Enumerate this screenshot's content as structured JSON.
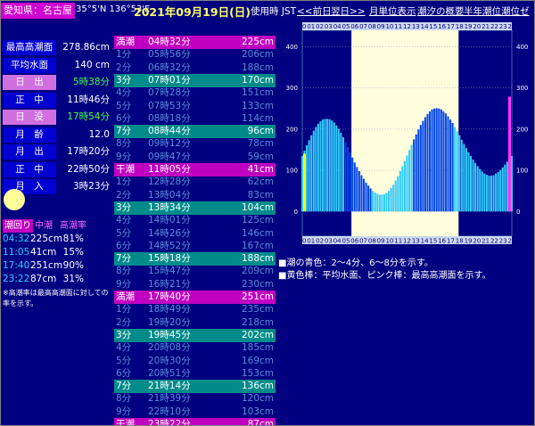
{
  "header": {
    "location": "愛知県：名古屋",
    "coord": "35°5'N 136°53'E",
    "date": "2021年09月19日(日)",
    "jst": "使用時 JST",
    "nav_prev": "<<前日",
    "nav_next": "翌日>>",
    "nav_month": "月単位表示",
    "nav_summary": "潮汐の概要",
    "nav_half": "半年潮位",
    "nav_zero": "潮位ゼロ"
  },
  "colors": {
    "background": "#000080",
    "high_water": "#c000c0",
    "mid_water": "#008b8b",
    "label_blue": "#0000d0",
    "label_pink": "#d070e0",
    "sunrise_text": "#44ff44"
  },
  "stats": [
    {
      "label": "最高高潮面",
      "value": "278.86cm",
      "pink": false,
      "green": false
    },
    {
      "label": "平均水面",
      "value": "140 cm",
      "pink": false,
      "green": false
    },
    {
      "label": "日　出",
      "value": "5時38分",
      "pink": true,
      "green": true
    },
    {
      "label": "正　中",
      "value": "11時46分",
      "pink": false,
      "green": false
    },
    {
      "label": "日　没",
      "value": "17時54分",
      "pink": true,
      "green": true
    },
    {
      "label": "月　齢",
      "value": "12.0",
      "pink": false,
      "green": false
    },
    {
      "label": "月　出",
      "value": "17時20分",
      "pink": false,
      "green": false
    },
    {
      "label": "正　中",
      "value": "22時50分",
      "pink": false,
      "green": false
    },
    {
      "label": "月　入",
      "value": "3時23分",
      "pink": false,
      "green": false
    }
  ],
  "tide_legend": {
    "label_full": "潮回り",
    "label_mid": "中潮",
    "label_rate": "高潮率"
  },
  "tide_summary": [
    {
      "time": "04:32",
      "level": "225cm",
      "rate": "81%"
    },
    {
      "time": "11:05",
      "level": "41cm",
      "rate": "15%"
    },
    {
      "time": "17:40",
      "level": "251cm",
      "rate": "90%"
    },
    {
      "time": "23:22",
      "level": "87cm",
      "rate": "31%"
    }
  ],
  "note": "※高潮率は最高高潮面に対しての率を示す。",
  "tide_table": [
    {
      "name": "満潮",
      "time": "04時32分",
      "level": "225cm",
      "type": "high"
    },
    {
      "name": "1分",
      "time": "05時56分",
      "level": "206cm",
      "type": ""
    },
    {
      "name": "2分",
      "time": "06時32分",
      "level": "188cm",
      "type": ""
    },
    {
      "name": "3分",
      "time": "07時01分",
      "level": "170cm",
      "type": "mid"
    },
    {
      "name": "4分",
      "time": "07時28分",
      "level": "151cm",
      "type": ""
    },
    {
      "name": "5分",
      "time": "07時53分",
      "level": "133cm",
      "type": ""
    },
    {
      "name": "6分",
      "time": "08時18分",
      "level": "114cm",
      "type": ""
    },
    {
      "name": "7分",
      "time": "08時44分",
      "level": "96cm",
      "type": "mid"
    },
    {
      "name": "8分",
      "time": "09時12分",
      "level": "78cm",
      "type": ""
    },
    {
      "name": "9分",
      "time": "09時47分",
      "level": "59cm",
      "type": ""
    },
    {
      "name": "干潮",
      "time": "11時05分",
      "level": "41cm",
      "type": "high"
    },
    {
      "name": "1分",
      "time": "12時28分",
      "level": "62cm",
      "type": ""
    },
    {
      "name": "2分",
      "time": "13時04分",
      "level": "83cm",
      "type": ""
    },
    {
      "name": "3分",
      "time": "13時34分",
      "level": "104cm",
      "type": "mid"
    },
    {
      "name": "4分",
      "time": "14時01分",
      "level": "125cm",
      "type": ""
    },
    {
      "name": "5分",
      "time": "14時26分",
      "level": "146cm",
      "type": ""
    },
    {
      "name": "6分",
      "time": "14時52分",
      "level": "167cm",
      "type": ""
    },
    {
      "name": "7分",
      "time": "15時18分",
      "level": "188cm",
      "type": "mid"
    },
    {
      "name": "8分",
      "time": "15時47分",
      "level": "209cm",
      "type": ""
    },
    {
      "name": "9分",
      "time": "16時21分",
      "level": "230cm",
      "type": ""
    },
    {
      "name": "満潮",
      "time": "17時40分",
      "level": "251cm",
      "type": "high"
    },
    {
      "name": "1分",
      "time": "18時49分",
      "level": "235cm",
      "type": ""
    },
    {
      "name": "2分",
      "time": "19時20分",
      "level": "218cm",
      "type": ""
    },
    {
      "name": "3分",
      "time": "19時45分",
      "level": "202cm",
      "type": "mid"
    },
    {
      "name": "4分",
      "time": "20時08分",
      "level": "185cm",
      "type": ""
    },
    {
      "name": "5分",
      "time": "20時30分",
      "level": "169cm",
      "type": ""
    },
    {
      "name": "6分",
      "time": "20時51分",
      "level": "153cm",
      "type": ""
    },
    {
      "name": "7分",
      "time": "21時14分",
      "level": "136cm",
      "type": "mid"
    },
    {
      "name": "8分",
      "time": "21時39分",
      "level": "120cm",
      "type": ""
    },
    {
      "name": "9分",
      "time": "22時10分",
      "level": "103cm",
      "type": ""
    },
    {
      "name": "干潮",
      "time": "23時22分",
      "level": "87cm",
      "type": "high"
    }
  ],
  "chart_captions": [
    "■潮の青色：2～4分、6～8分を示す。",
    "■黄色棒：平均水面、ピンク棒：最高高潮面を示す。"
  ],
  "chart_data": {
    "type": "bar",
    "x_hours": [
      "00",
      "01",
      "02",
      "03",
      "04",
      "05",
      "06",
      "07",
      "08",
      "09",
      "10",
      "11",
      "12",
      "13",
      "14",
      "15",
      "16",
      "17",
      "18",
      "19",
      "20",
      "21",
      "22",
      "23",
      "24"
    ],
    "y_ticks": [
      "0",
      "100",
      "200",
      "300",
      "400"
    ],
    "ylim": [
      -60,
      440
    ],
    "daylight_hours": [
      5.63,
      17.9
    ],
    "mean_level": 140,
    "max_level": 279,
    "levels": [
      135,
      148,
      161,
      173,
      185,
      196,
      205,
      213,
      219,
      223,
      225,
      225,
      224,
      221,
      216,
      209,
      201,
      191,
      180,
      168,
      156,
      143,
      131,
      119,
      108,
      98,
      88,
      79,
      70,
      63,
      56,
      50,
      46,
      43,
      41,
      41,
      42,
      45,
      50,
      57,
      65,
      75,
      86,
      98,
      110,
      123,
      136,
      149,
      162,
      175,
      187,
      199,
      210,
      220,
      229,
      237,
      243,
      248,
      250,
      251,
      250,
      248,
      243,
      238,
      231,
      223,
      215,
      205,
      195,
      185,
      174,
      164,
      154,
      144,
      135,
      126,
      118,
      110,
      103,
      97,
      92,
      89,
      87,
      87,
      88,
      92,
      96,
      101,
      107,
      114,
      121,
      128,
      135
    ],
    "level_colors": [
      "c",
      "c",
      "c",
      "c",
      "c",
      "c",
      "c",
      "c",
      "c",
      "c",
      "c",
      "c",
      "c",
      "c",
      "c",
      "c",
      "c",
      "c",
      "c",
      "d",
      "d",
      "d",
      "d",
      "d",
      "d",
      "d",
      "d",
      "d",
      "d",
      "d",
      "d",
      "c",
      "c",
      "c",
      "c",
      "c",
      "c",
      "c",
      "c",
      "c",
      "c",
      "c",
      "c",
      "c",
      "c",
      "c",
      "c",
      "c",
      "c",
      "d",
      "d",
      "d",
      "d",
      "d",
      "d",
      "d",
      "d",
      "d",
      "d",
      "d",
      "d",
      "d",
      "d",
      "d",
      "d",
      "d",
      "d",
      "c",
      "c",
      "c",
      "c",
      "c",
      "c",
      "c",
      "c",
      "c",
      "c",
      "c",
      "c",
      "c",
      "c",
      "c",
      "c",
      "c",
      "c",
      "c",
      "c",
      "c",
      "c",
      "c",
      "c",
      "c",
      "c"
    ]
  }
}
